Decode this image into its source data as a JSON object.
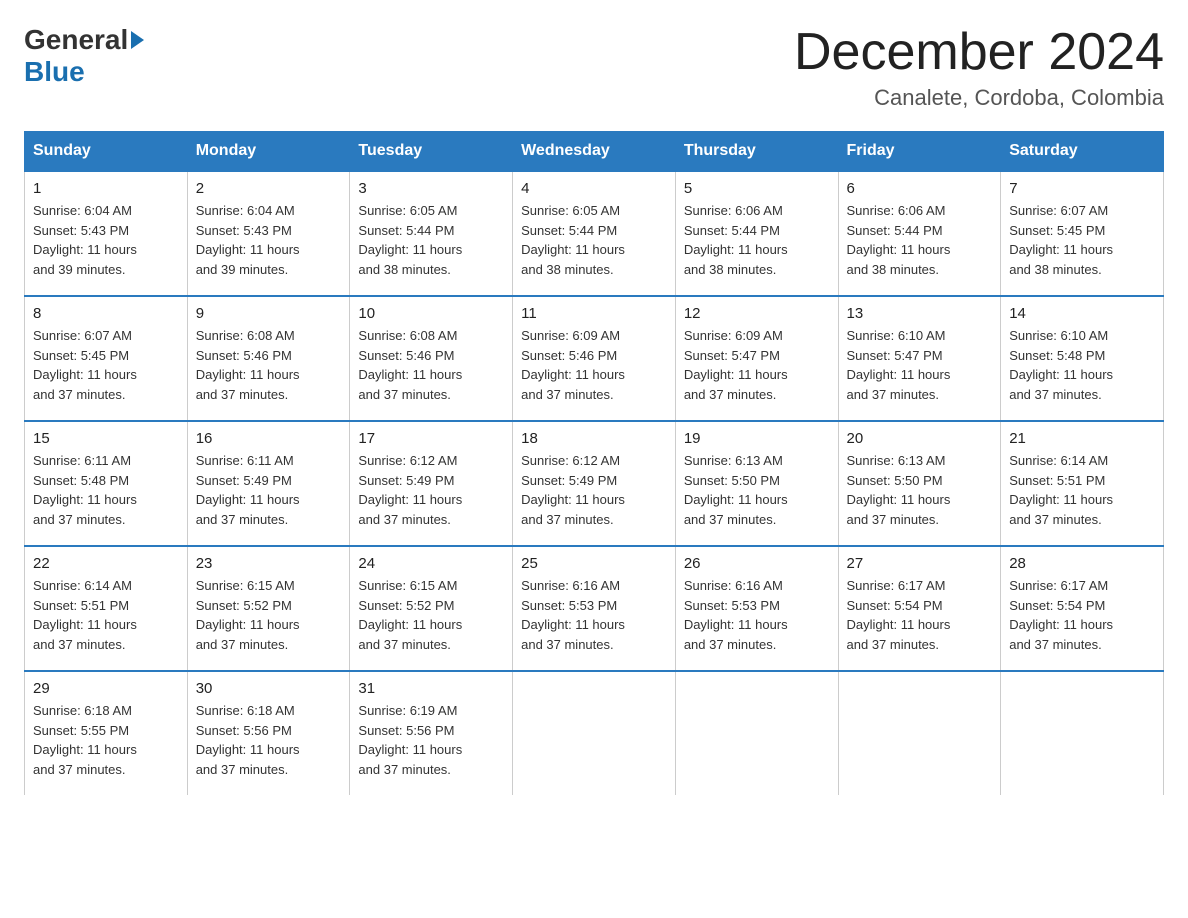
{
  "header": {
    "logo_general": "General",
    "logo_blue": "Blue",
    "month_year": "December 2024",
    "location": "Canalete, Cordoba, Colombia"
  },
  "weekdays": [
    "Sunday",
    "Monday",
    "Tuesday",
    "Wednesday",
    "Thursday",
    "Friday",
    "Saturday"
  ],
  "weeks": [
    [
      {
        "day": "1",
        "sunrise": "6:04 AM",
        "sunset": "5:43 PM",
        "daylight": "11 hours and 39 minutes."
      },
      {
        "day": "2",
        "sunrise": "6:04 AM",
        "sunset": "5:43 PM",
        "daylight": "11 hours and 39 minutes."
      },
      {
        "day": "3",
        "sunrise": "6:05 AM",
        "sunset": "5:44 PM",
        "daylight": "11 hours and 38 minutes."
      },
      {
        "day": "4",
        "sunrise": "6:05 AM",
        "sunset": "5:44 PM",
        "daylight": "11 hours and 38 minutes."
      },
      {
        "day": "5",
        "sunrise": "6:06 AM",
        "sunset": "5:44 PM",
        "daylight": "11 hours and 38 minutes."
      },
      {
        "day": "6",
        "sunrise": "6:06 AM",
        "sunset": "5:44 PM",
        "daylight": "11 hours and 38 minutes."
      },
      {
        "day": "7",
        "sunrise": "6:07 AM",
        "sunset": "5:45 PM",
        "daylight": "11 hours and 38 minutes."
      }
    ],
    [
      {
        "day": "8",
        "sunrise": "6:07 AM",
        "sunset": "5:45 PM",
        "daylight": "11 hours and 37 minutes."
      },
      {
        "day": "9",
        "sunrise": "6:08 AM",
        "sunset": "5:46 PM",
        "daylight": "11 hours and 37 minutes."
      },
      {
        "day": "10",
        "sunrise": "6:08 AM",
        "sunset": "5:46 PM",
        "daylight": "11 hours and 37 minutes."
      },
      {
        "day": "11",
        "sunrise": "6:09 AM",
        "sunset": "5:46 PM",
        "daylight": "11 hours and 37 minutes."
      },
      {
        "day": "12",
        "sunrise": "6:09 AM",
        "sunset": "5:47 PM",
        "daylight": "11 hours and 37 minutes."
      },
      {
        "day": "13",
        "sunrise": "6:10 AM",
        "sunset": "5:47 PM",
        "daylight": "11 hours and 37 minutes."
      },
      {
        "day": "14",
        "sunrise": "6:10 AM",
        "sunset": "5:48 PM",
        "daylight": "11 hours and 37 minutes."
      }
    ],
    [
      {
        "day": "15",
        "sunrise": "6:11 AM",
        "sunset": "5:48 PM",
        "daylight": "11 hours and 37 minutes."
      },
      {
        "day": "16",
        "sunrise": "6:11 AM",
        "sunset": "5:49 PM",
        "daylight": "11 hours and 37 minutes."
      },
      {
        "day": "17",
        "sunrise": "6:12 AM",
        "sunset": "5:49 PM",
        "daylight": "11 hours and 37 minutes."
      },
      {
        "day": "18",
        "sunrise": "6:12 AM",
        "sunset": "5:49 PM",
        "daylight": "11 hours and 37 minutes."
      },
      {
        "day": "19",
        "sunrise": "6:13 AM",
        "sunset": "5:50 PM",
        "daylight": "11 hours and 37 minutes."
      },
      {
        "day": "20",
        "sunrise": "6:13 AM",
        "sunset": "5:50 PM",
        "daylight": "11 hours and 37 minutes."
      },
      {
        "day": "21",
        "sunrise": "6:14 AM",
        "sunset": "5:51 PM",
        "daylight": "11 hours and 37 minutes."
      }
    ],
    [
      {
        "day": "22",
        "sunrise": "6:14 AM",
        "sunset": "5:51 PM",
        "daylight": "11 hours and 37 minutes."
      },
      {
        "day": "23",
        "sunrise": "6:15 AM",
        "sunset": "5:52 PM",
        "daylight": "11 hours and 37 minutes."
      },
      {
        "day": "24",
        "sunrise": "6:15 AM",
        "sunset": "5:52 PM",
        "daylight": "11 hours and 37 minutes."
      },
      {
        "day": "25",
        "sunrise": "6:16 AM",
        "sunset": "5:53 PM",
        "daylight": "11 hours and 37 minutes."
      },
      {
        "day": "26",
        "sunrise": "6:16 AM",
        "sunset": "5:53 PM",
        "daylight": "11 hours and 37 minutes."
      },
      {
        "day": "27",
        "sunrise": "6:17 AM",
        "sunset": "5:54 PM",
        "daylight": "11 hours and 37 minutes."
      },
      {
        "day": "28",
        "sunrise": "6:17 AM",
        "sunset": "5:54 PM",
        "daylight": "11 hours and 37 minutes."
      }
    ],
    [
      {
        "day": "29",
        "sunrise": "6:18 AM",
        "sunset": "5:55 PM",
        "daylight": "11 hours and 37 minutes."
      },
      {
        "day": "30",
        "sunrise": "6:18 AM",
        "sunset": "5:56 PM",
        "daylight": "11 hours and 37 minutes."
      },
      {
        "day": "31",
        "sunrise": "6:19 AM",
        "sunset": "5:56 PM",
        "daylight": "11 hours and 37 minutes."
      },
      null,
      null,
      null,
      null
    ]
  ],
  "labels": {
    "sunrise": "Sunrise:",
    "sunset": "Sunset:",
    "daylight": "Daylight:"
  }
}
